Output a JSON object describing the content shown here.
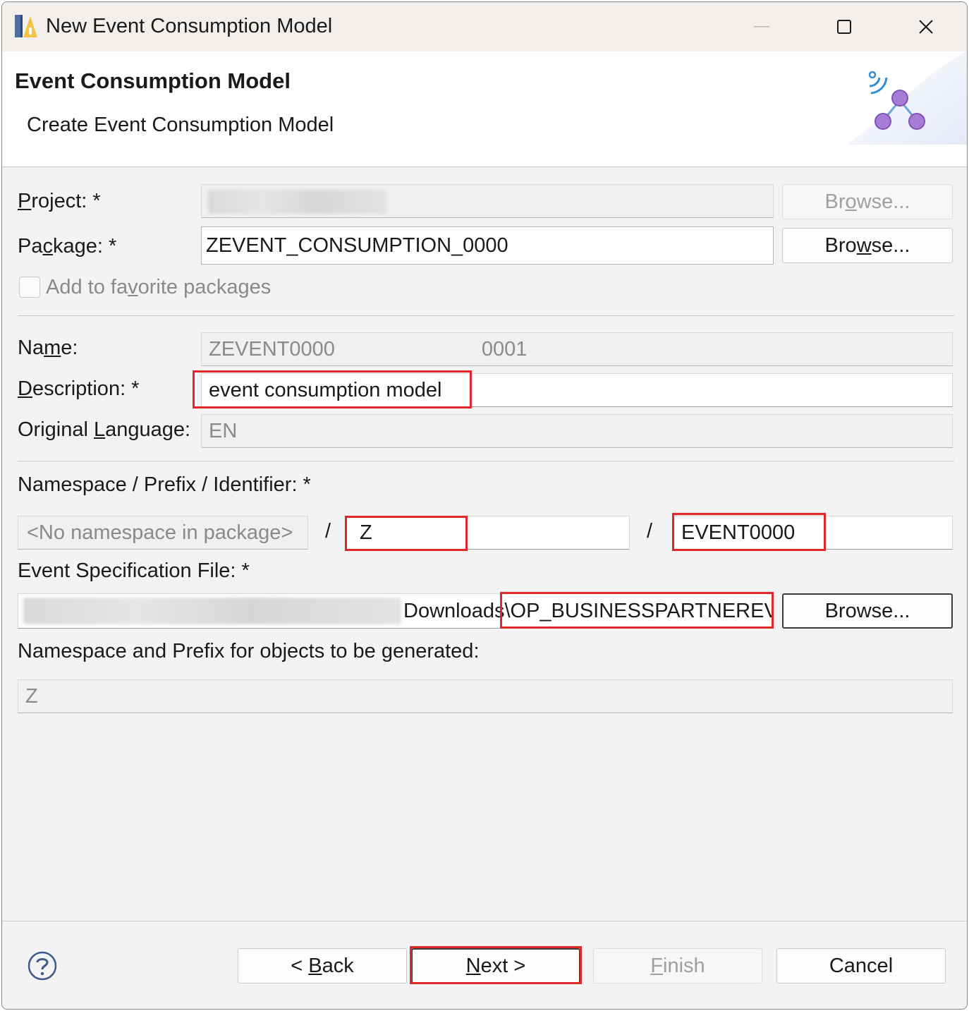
{
  "window": {
    "title": "New Event Consumption Model",
    "minimize_icon": "minimize-icon",
    "maximize_icon": "maximize-icon",
    "close_icon": "close-icon"
  },
  "header": {
    "title": "Event Consumption Model",
    "subtitle": "Create Event Consumption Model",
    "icon": "event-network-icon"
  },
  "form": {
    "project": {
      "label_pre": "",
      "label_hot": "P",
      "label_post": "roject: *",
      "value": "",
      "browse_label_pre": "Br",
      "browse_hot": "o",
      "browse_post": "wse..."
    },
    "package": {
      "label_pre": "Pa",
      "label_hot": "c",
      "label_post": "kage: *",
      "value": "ZEVENT_CONSUMPTION_0000",
      "browse_label_pre": "Bro",
      "browse_hot": "w",
      "browse_post": "se..."
    },
    "favorite": {
      "label_pre": "Add to fa",
      "label_hot": "v",
      "label_post": "orite packages",
      "checked": false
    },
    "name": {
      "label_pre": "Na",
      "label_hot": "m",
      "label_post": "e:",
      "value_part1": "ZEVENT0000",
      "value_part2": "0001"
    },
    "description": {
      "label_pre": "",
      "label_hot": "D",
      "label_post": "escription: *",
      "value": "event consumption model"
    },
    "original_language": {
      "label_pre": "Original ",
      "label_hot": "L",
      "label_post": "anguage:",
      "value": "EN"
    },
    "namespace": {
      "label": "Namespace / Prefix / Identifier: *",
      "namespace_placeholder": "<No namespace in package>",
      "separator": "/",
      "prefix": "Z",
      "identifier": "EVENT0000"
    },
    "spec_file": {
      "label": "Event Specification File: *",
      "value_visible": "Downloads\\OP_BUSINESSPARTNEREVENT",
      "browse_label": "Browse..."
    },
    "generated": {
      "label": "Namespace and Prefix for objects to be generated:",
      "value": "Z"
    }
  },
  "footer": {
    "help_icon": "help-icon",
    "back": {
      "pre": "< ",
      "hot": "B",
      "post": "ack"
    },
    "next": {
      "pre": "",
      "hot": "N",
      "post": "ext >"
    },
    "finish": {
      "pre": "",
      "hot": "F",
      "post": "inish"
    },
    "cancel": "Cancel"
  },
  "colors": {
    "highlight": "#e0282c",
    "title_bar": "#f3efec",
    "dialog_bg": "#f3f3f3",
    "icon_purple": "#a57bd6",
    "icon_blue": "#2d8fd8"
  }
}
